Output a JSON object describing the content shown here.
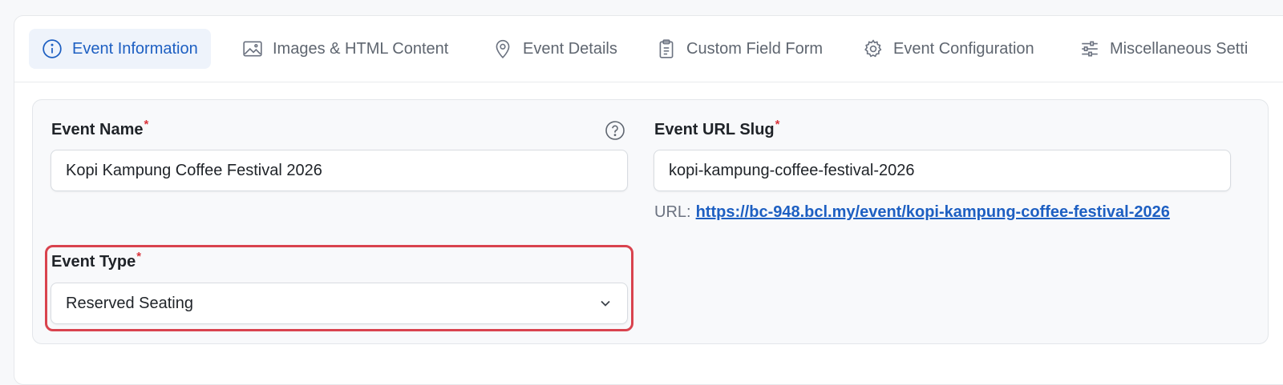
{
  "tabs": [
    {
      "label": "Event Information",
      "icon": "info-icon",
      "active": true
    },
    {
      "label": "Images & HTML Content",
      "icon": "image-icon",
      "active": false
    },
    {
      "label": "Event Details",
      "icon": "map-pin-icon",
      "active": false
    },
    {
      "label": "Custom Field Form",
      "icon": "clipboard-icon",
      "active": false
    },
    {
      "label": "Event Configuration",
      "icon": "gear-icon",
      "active": false
    },
    {
      "label": "Miscellaneous Setti",
      "icon": "sliders-icon",
      "active": false
    }
  ],
  "form": {
    "event_name": {
      "label": "Event Name",
      "required": "*",
      "value": "Kopi Kampung Coffee Festival 2026"
    },
    "event_url_slug": {
      "label": "Event URL Slug",
      "required": "*",
      "value": "kopi-kampung-coffee-festival-2026"
    },
    "url": {
      "prefix": "URL:",
      "link": "https://bc-948.bcl.my/event/kopi-kampung-coffee-festival-2026"
    },
    "event_type": {
      "label": "Event Type",
      "required": "*",
      "selected": "Reserved Seating"
    }
  },
  "colors": {
    "accent": "#1d5fc2",
    "required": "#d9343b",
    "highlight": "#d9434e"
  }
}
